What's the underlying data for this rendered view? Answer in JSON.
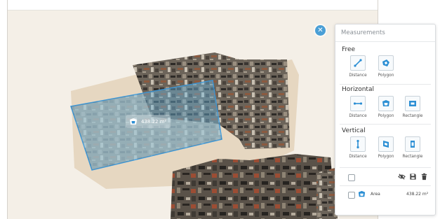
{
  "area_badge": {
    "value": "438.22 m²"
  },
  "panel": {
    "title": "Measurements",
    "sections": [
      {
        "heading": "Free",
        "tools": [
          {
            "label": "Distance",
            "icon": "line-distance-icon"
          },
          {
            "label": "Polygon",
            "icon": "polygon-icon"
          }
        ]
      },
      {
        "heading": "Horizontal",
        "tools": [
          {
            "label": "Distance",
            "icon": "horizontal-distance-icon"
          },
          {
            "label": "Polygon",
            "icon": "polygon-icon"
          },
          {
            "label": "Rectangle",
            "icon": "rectangle-icon"
          }
        ]
      },
      {
        "heading": "Vertical",
        "tools": [
          {
            "label": "Distance",
            "icon": "vertical-distance-icon"
          },
          {
            "label": "Polygon",
            "icon": "polygon-icon"
          },
          {
            "label": "Rectangle",
            "icon": "rectangle-icon"
          }
        ]
      }
    ],
    "list": {
      "rows": [
        {
          "name": "Area",
          "value": "438.22 m²",
          "icon": "area-icon"
        }
      ]
    }
  },
  "colors": {
    "accent": "#2c8fd4",
    "selection": "#6ab8e6"
  }
}
